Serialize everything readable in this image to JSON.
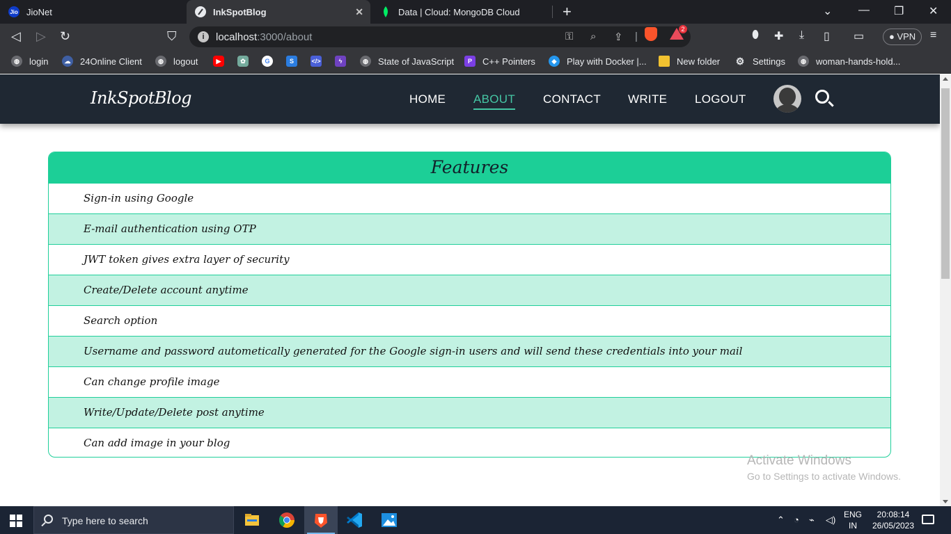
{
  "browser": {
    "tabs": [
      {
        "title": "JioNet",
        "favicon_text": "Jio",
        "active": false
      },
      {
        "title": "InkSpotBlog",
        "active": true
      },
      {
        "title": "Data | Cloud: MongoDB Cloud",
        "active": false
      }
    ],
    "url_host": "localhost",
    "url_path": ":3000/about",
    "vpn_label": "VPN",
    "rewards_badge": "2",
    "bookmarks": [
      {
        "label": "login",
        "icon": "globe-icon"
      },
      {
        "label": "24Online Client",
        "icon": "cloud-icon"
      },
      {
        "label": "logout",
        "icon": "globe-icon"
      },
      {
        "label": "",
        "icon": "youtube-icon"
      },
      {
        "label": "",
        "icon": "chatgpt-icon"
      },
      {
        "label": "",
        "icon": "google-icon"
      },
      {
        "label": "",
        "icon": "s-icon"
      },
      {
        "label": "",
        "icon": "code-icon"
      },
      {
        "label": "",
        "icon": "bolt-icon"
      },
      {
        "label": "State of JavaScript",
        "icon": "globe-icon"
      },
      {
        "label": "C++ Pointers",
        "icon": "p-icon"
      },
      {
        "label": "Play with Docker |...",
        "icon": "docker-icon"
      },
      {
        "label": "New folder",
        "icon": "folder-icon"
      },
      {
        "label": "Settings",
        "icon": "gear-icon"
      },
      {
        "label": "woman-hands-hold...",
        "icon": "globe-icon"
      }
    ]
  },
  "site": {
    "logo": "InkSpotBlog",
    "nav": [
      {
        "label": "HOME",
        "active": false
      },
      {
        "label": "ABOUT",
        "active": true
      },
      {
        "label": "CONTACT",
        "active": false
      },
      {
        "label": "WRITE",
        "active": false
      },
      {
        "label": "LOGOUT",
        "active": false
      }
    ]
  },
  "features": {
    "title": "Features",
    "items": [
      "Sign-in using Google",
      "E-mail authentication using OTP",
      "JWT token gives extra layer of security",
      "Create/Delete account anytime",
      "Search option",
      "Username and password autometically generated for the Google sign-in users and will send these credentials into your mail",
      "Can change profile image",
      "Write/Update/Delete post anytime",
      "Can add image in your blog"
    ]
  },
  "watermark": {
    "line1": "Activate Windows",
    "line2": "Go to Settings to activate Windows."
  },
  "taskbar": {
    "search_placeholder": "Type here to search",
    "lang_line1": "ENG",
    "lang_line2": "IN",
    "time": "20:08:14",
    "date": "26/05/2023"
  },
  "colors": {
    "accent": "#1ccf97",
    "row_alt": "#c2f2e2",
    "nav_bg": "#1f2833",
    "nav_active": "#45c6a4"
  }
}
